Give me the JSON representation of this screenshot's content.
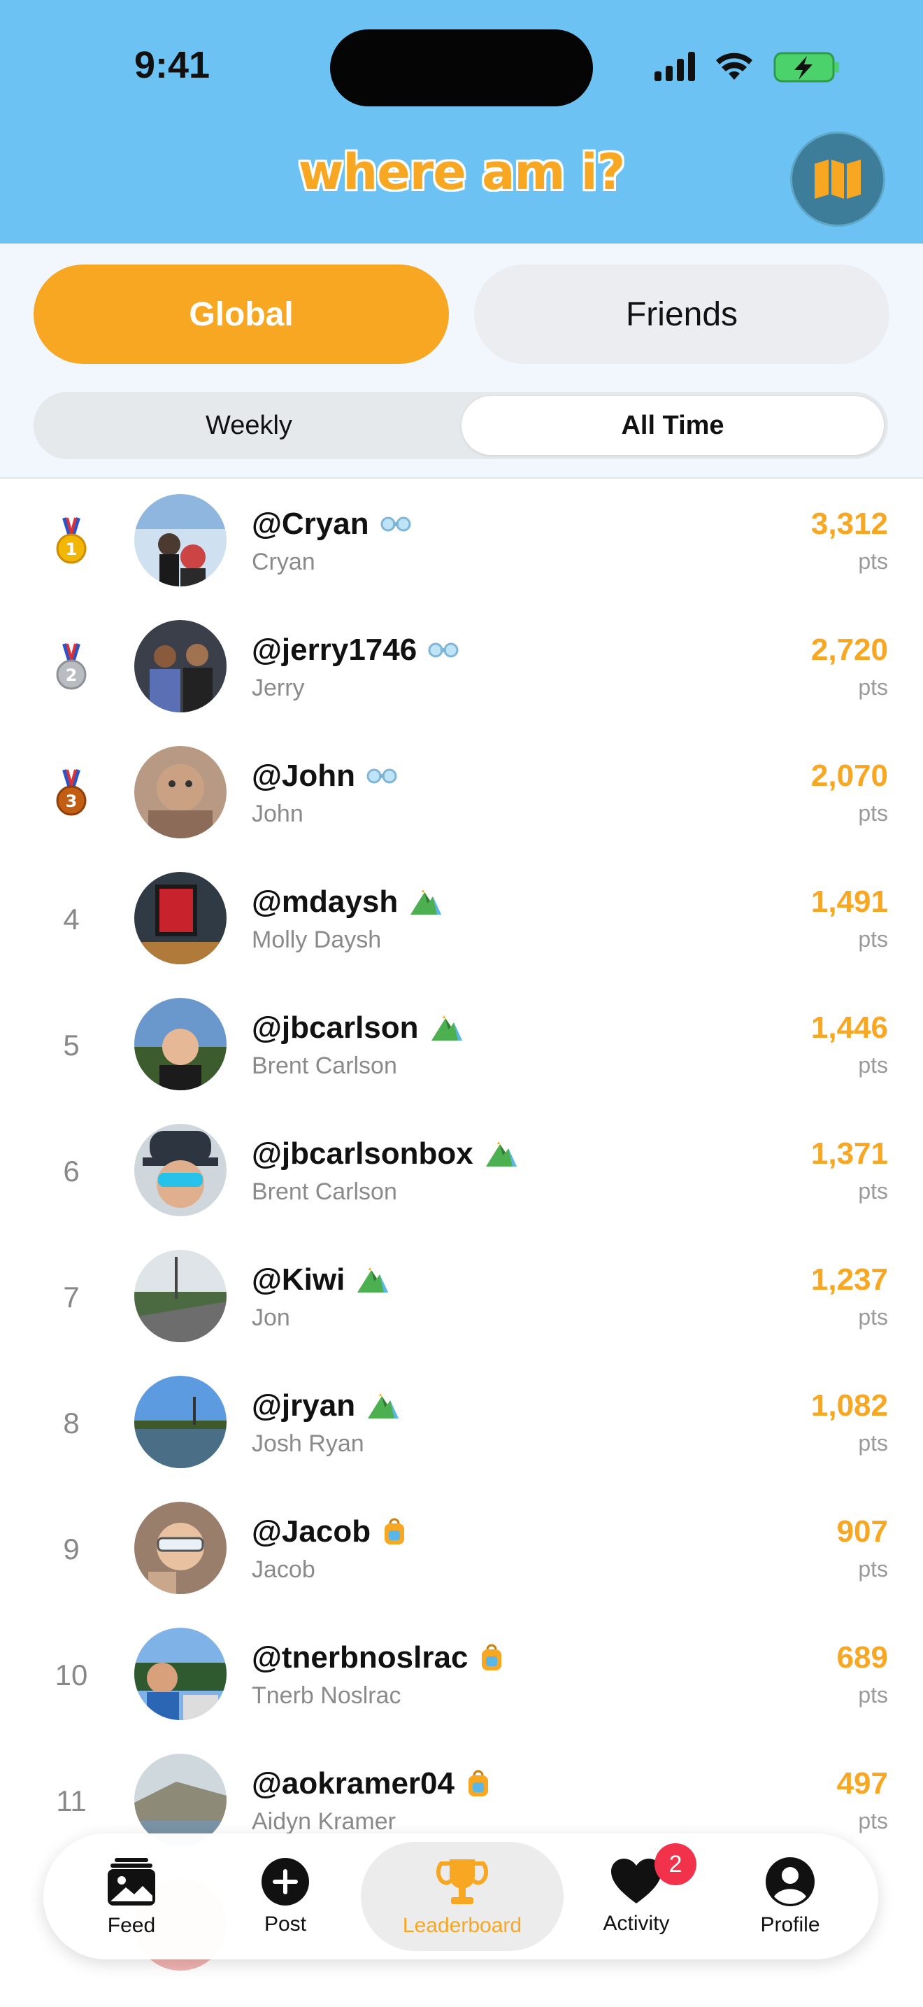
{
  "status_bar": {
    "time": "9:41"
  },
  "header": {
    "title": "where am i?"
  },
  "tabs": {
    "scope": [
      "Global",
      "Friends"
    ],
    "scope_selected": "Global",
    "period": [
      "Weekly",
      "All Time"
    ],
    "period_selected": "All Time"
  },
  "leaderboard": [
    {
      "rank": "1",
      "medal": "gold",
      "username": "@Cryan",
      "name": "Cryan",
      "points": "3,312",
      "pts_label": "pts",
      "badge": "binoculars-icon"
    },
    {
      "rank": "2",
      "medal": "silver",
      "username": "@jerry1746",
      "name": "Jerry",
      "points": "2,720",
      "pts_label": "pts",
      "badge": "binoculars-icon"
    },
    {
      "rank": "3",
      "medal": "bronze",
      "username": "@John",
      "name": "John",
      "points": "2,070",
      "pts_label": "pts",
      "badge": "binoculars-icon"
    },
    {
      "rank": "4",
      "username": "@mdaysh",
      "name": "Molly Daysh",
      "points": "1,491",
      "pts_label": "pts",
      "badge": "mountain-icon"
    },
    {
      "rank": "5",
      "username": "@jbcarlson",
      "name": "Brent Carlson",
      "points": "1,446",
      "pts_label": "pts",
      "badge": "mountain-icon"
    },
    {
      "rank": "6",
      "username": "@jbcarlsonbox",
      "name": "Brent Carlson",
      "points": "1,371",
      "pts_label": "pts",
      "badge": "mountain-icon"
    },
    {
      "rank": "7",
      "username": "@Kiwi",
      "name": "Jon",
      "points": "1,237",
      "pts_label": "pts",
      "badge": "mountain-icon"
    },
    {
      "rank": "8",
      "username": "@jryan",
      "name": "Josh Ryan",
      "points": "1,082",
      "pts_label": "pts",
      "badge": "mountain-icon"
    },
    {
      "rank": "9",
      "username": "@Jacob",
      "name": "Jacob",
      "points": "907",
      "pts_label": "pts",
      "badge": "backpack-icon"
    },
    {
      "rank": "10",
      "username": "@tnerbnoslrac",
      "name": "Tnerb Noslrac",
      "points": "689",
      "pts_label": "pts",
      "badge": "backpack-icon"
    },
    {
      "rank": "11",
      "username": "@aokramer04",
      "name": "Aidyn Kramer",
      "points": "497",
      "pts_label": "pts",
      "badge": "backpack-icon"
    }
  ],
  "nav": {
    "items": [
      "Feed",
      "Post",
      "Leaderboard",
      "Activity",
      "Profile"
    ],
    "active": "Leaderboard",
    "activity_count": "2"
  },
  "colors": {
    "accent": "#f7a722",
    "header_bg": "#6cc3f3",
    "notif": "#f2314b"
  }
}
